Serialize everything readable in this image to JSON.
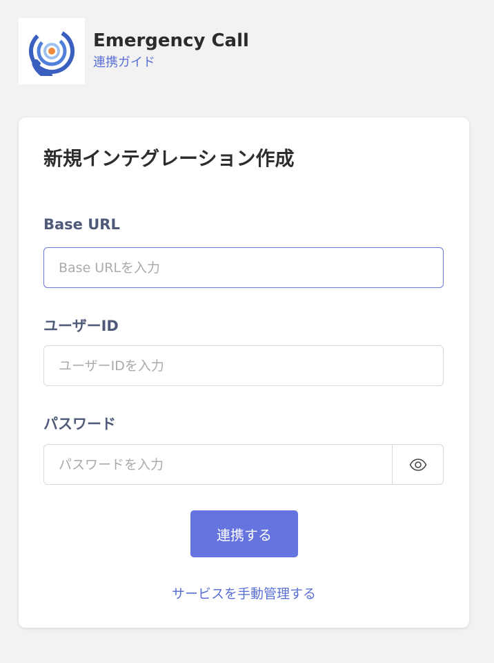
{
  "app": {
    "name": "Emergency Call",
    "guide_link": "連携ガイド",
    "logo_icon": "emergency-call-logo"
  },
  "form": {
    "title": "新規インテグレーション作成",
    "base_url": {
      "label": "Base URL",
      "placeholder": "Base URLを入力",
      "value": ""
    },
    "user_id": {
      "label": "ユーザーID",
      "placeholder": "ユーザーIDを入力",
      "value": ""
    },
    "password": {
      "label": "パスワード",
      "placeholder": "パスワードを入力",
      "value": "",
      "toggle_icon": "eye-icon"
    },
    "submit_label": "連携する",
    "manual_link": "サービスを手動管理する"
  },
  "colors": {
    "accent": "#6674df",
    "link": "#5a6fd6",
    "label": "#4f5a78",
    "focus_border": "#6a75d8",
    "logo_blue": "#3a5fbf",
    "logo_orange": "#f08a3a"
  }
}
